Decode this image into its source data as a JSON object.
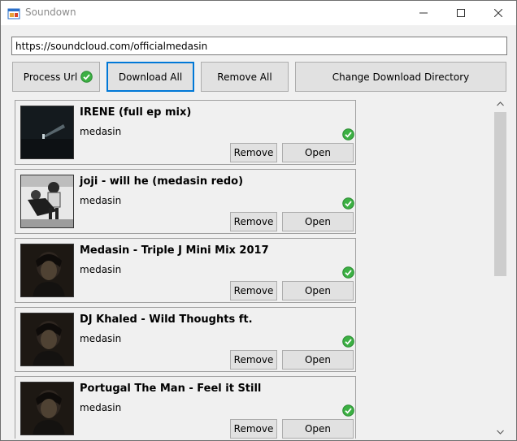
{
  "window": {
    "title": "Soundown",
    "icon": "windows-form-icon"
  },
  "toolbar": {
    "url_value": "https://soundcloud.com/officialmedasin",
    "process_label": "Process Url",
    "process_status_icon": "green-check-icon",
    "download_all_label": "Download All",
    "remove_all_label": "Remove All",
    "change_dir_label": "Change Download Directory"
  },
  "tracks": [
    {
      "title": "IRENE (full ep mix)",
      "artist": "medasin",
      "status": "complete",
      "remove_label": "Remove",
      "open_label": "Open",
      "art": "dark-scene"
    },
    {
      "title": "joji - will he (medasin redo)",
      "artist": "medasin",
      "status": "complete",
      "remove_label": "Remove",
      "open_label": "Open",
      "art": "bw-photo"
    },
    {
      "title": "Medasin - Triple J Mini Mix 2017",
      "artist": "medasin",
      "status": "complete",
      "remove_label": "Remove",
      "open_label": "Open",
      "art": "portrait"
    },
    {
      "title": "DJ Khaled - Wild Thoughts ft.",
      "artist": "medasin",
      "status": "complete",
      "remove_label": "Remove",
      "open_label": "Open",
      "art": "portrait"
    },
    {
      "title": "Portugal The Man - Feel it Still",
      "artist": "medasin",
      "status": "complete",
      "remove_label": "Remove",
      "open_label": "Open",
      "art": "portrait"
    }
  ],
  "colors": {
    "accent": "#0078d7",
    "success": "#3cb043"
  }
}
